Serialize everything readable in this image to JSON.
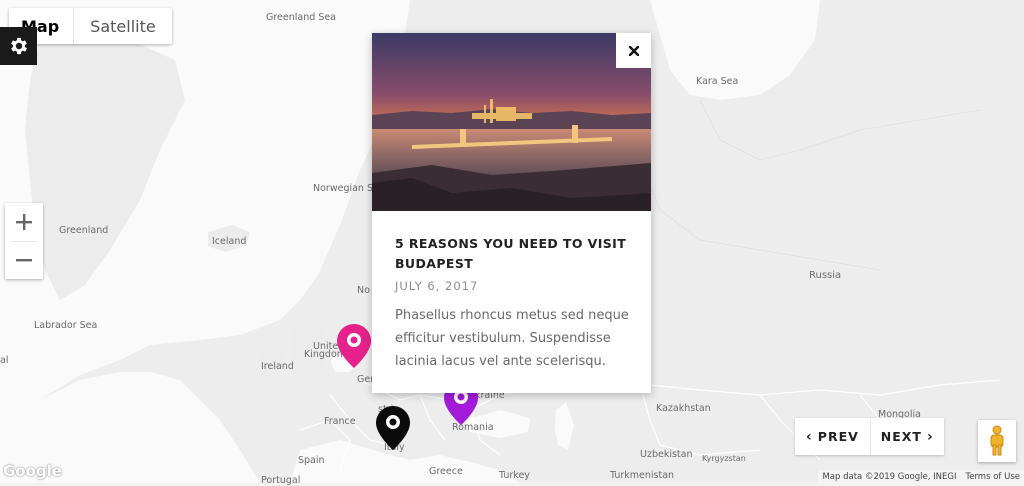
{
  "map_type": {
    "map_label": "Map",
    "satellite_label": "Satellite"
  },
  "icons": {
    "settings": "gear-icon",
    "zoom_in": "plus-icon",
    "zoom_out": "minus-icon",
    "close": "close-icon",
    "pegman": "pegman-icon",
    "marker": "map-pin-icon"
  },
  "labels": [
    "Greenland Sea",
    "Kara Sea",
    "Norwegian Sea",
    "Greenland",
    "Iceland",
    "Russia",
    "Labrador Sea",
    "United",
    "Kingdom",
    "Ireland",
    "Ger",
    "No",
    "Ukraine",
    "Romania",
    "Kazakhstan",
    "France",
    "Uzbekistan",
    "Kyrgyzstan",
    "Spain",
    "Greece",
    "Turkey",
    "Turkmenistan",
    "Portugal",
    "al",
    "Mongolia",
    "stria",
    "Italy"
  ],
  "info_card": {
    "title": "5 REASONS YOU NEED TO VISIT BUDAPEST",
    "date": "JULY 6, 2017",
    "excerpt": "Phasellus rhoncus metus sed neque efficitur vestibulum. Suspendisse lacinia lacus vel ante scelerisqu.",
    "image_alt": "Budapest at sunset"
  },
  "markers": [
    {
      "color": "#e5228b"
    },
    {
      "color": "#a31bd9"
    },
    {
      "color": "#0b0b0b"
    }
  ],
  "pager": {
    "prev": "PREV",
    "next": "NEXT"
  },
  "attribution": {
    "data": "Map data ©2019 Google, INEGI",
    "terms": "Terms of Use"
  },
  "logo": "Google",
  "colors": {
    "land": "#ededed",
    "water": "#fafafa",
    "border": "#ffffff",
    "pink_pin": "#e5228b",
    "purple_pin": "#a31bd9",
    "black_pin": "#0b0b0b"
  }
}
